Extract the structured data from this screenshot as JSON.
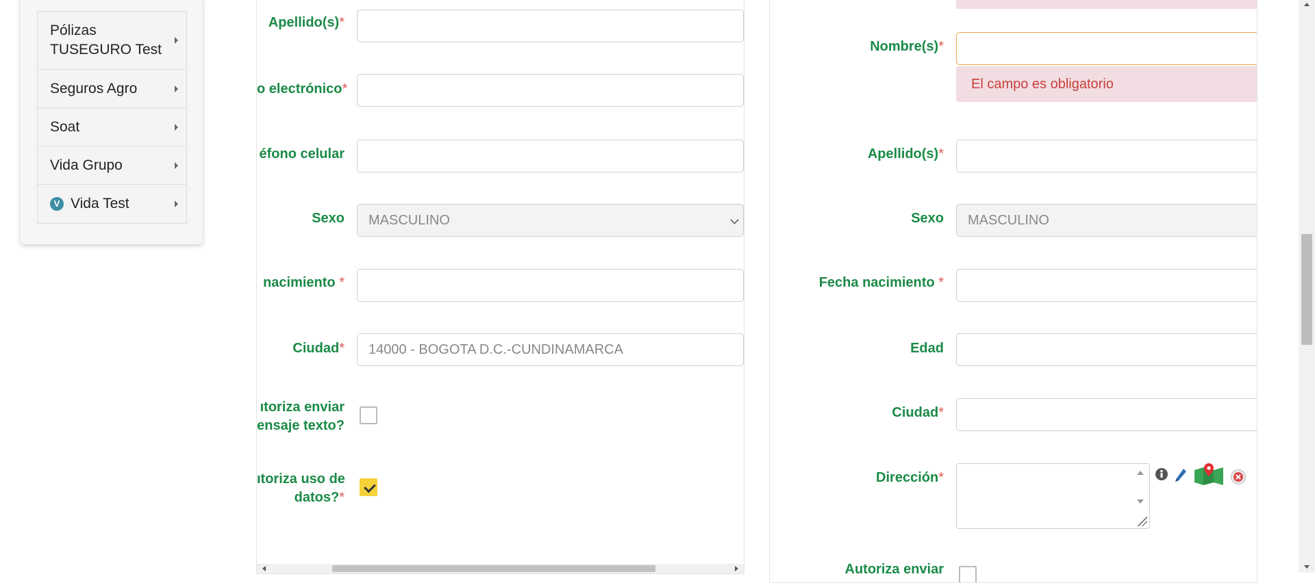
{
  "sidebar": {
    "items": [
      {
        "label": "Pólizas TUSEGURO Test",
        "icon": ""
      },
      {
        "label": "Seguros Agro",
        "icon": ""
      },
      {
        "label": "Soat",
        "icon": ""
      },
      {
        "label": "Vida Grupo",
        "icon": ""
      },
      {
        "label": "Vida Test",
        "icon": "V"
      }
    ]
  },
  "left_form": {
    "apellidos_label": "Apellido(s)",
    "correo_label": "o electrónico",
    "telefono_label": "éfono celular",
    "sexo_label": "Sexo",
    "sexo_value": "MASCULINO",
    "nacimiento_label": "nacimiento",
    "ciudad_label": "Ciudad",
    "ciudad_value": "14000 - BOGOTA D.C.-CUNDINAMARCA",
    "autoriza_texto_line1": "ıtoriza enviar",
    "autoriza_texto_line2": "ensaje texto?",
    "autoriza_texto_checked": false,
    "autoriza_datos_line1": "ıtoriza uso de",
    "autoriza_datos_line2": "datos?",
    "autoriza_datos_checked": true
  },
  "right_form": {
    "nombres_label": "Nombre(s)",
    "nombres_error": "El campo es obligatorio",
    "apellidos_label": "Apellido(s)",
    "sexo_label": "Sexo",
    "sexo_value": "MASCULINO",
    "nacimiento_label": "Fecha nacimiento",
    "edad_label": "Edad",
    "ciudad_label": "Ciudad",
    "direccion_label": "Dirección",
    "autoriza_cut_label": "Autoriza enviar"
  },
  "required_mark": "*",
  "icons": {
    "info": "info-icon",
    "edit": "pencil-icon",
    "map": "map-pin-icon",
    "clear": "close-icon"
  },
  "colors": {
    "label_green": "#1a8a46",
    "required_red": "#e25656",
    "error_bg": "#f2dde2",
    "error_text": "#c9403d",
    "checkbox_yellow": "#f5d13a"
  }
}
